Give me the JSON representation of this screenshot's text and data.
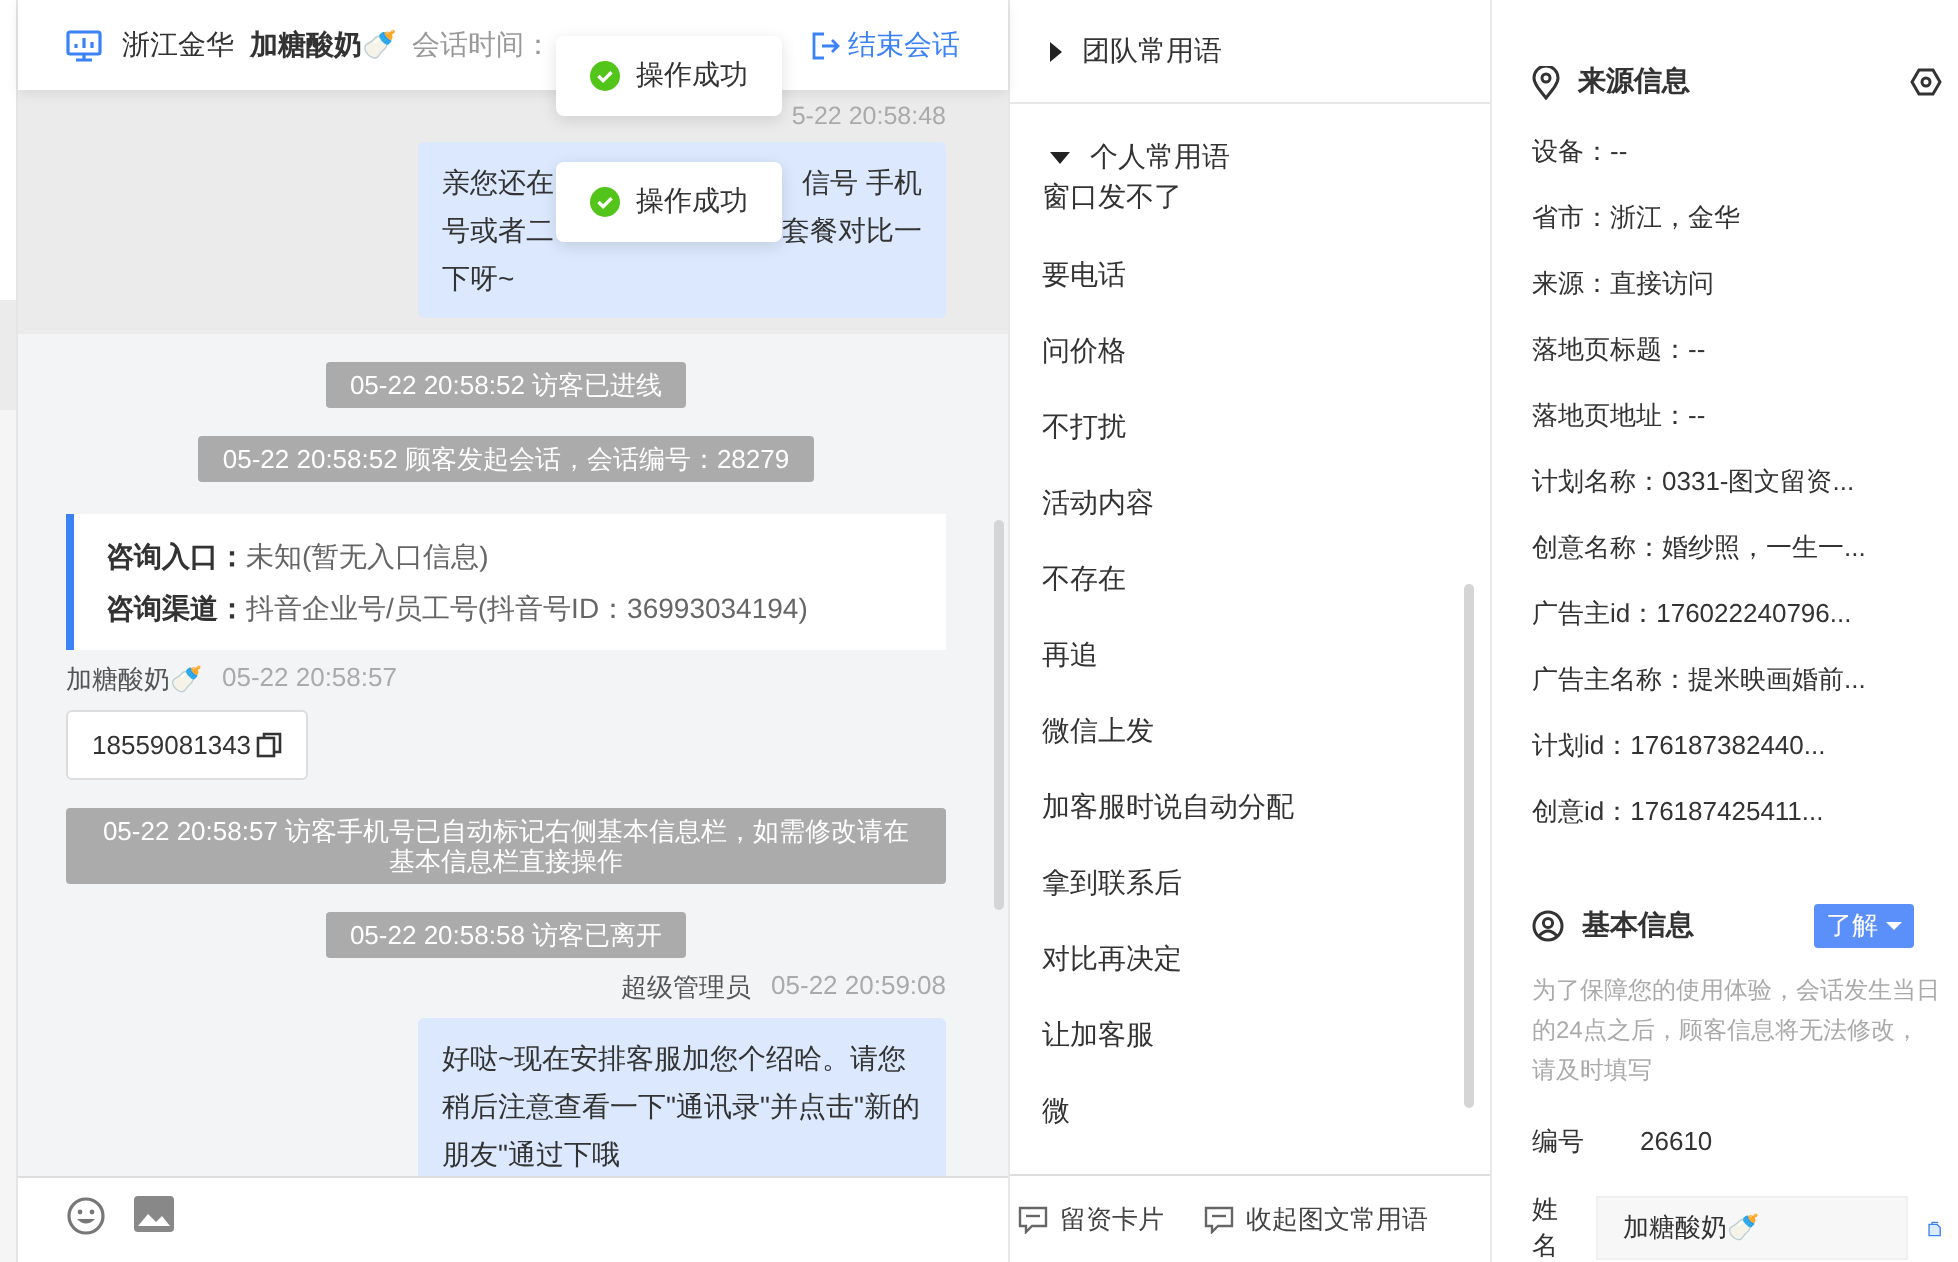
{
  "header": {
    "region": "浙江金华",
    "visitor": "加糖酸奶🍼",
    "session_time": "会话时间：",
    "end_button": "结束会话"
  },
  "toasts": [
    {
      "text": "操作成功"
    },
    {
      "text": "操作成功"
    }
  ],
  "messages": [
    {
      "kind": "agent_partial",
      "time": "5-22 20:58:48",
      "lines": [
        [
          "亲您还在",
          "信号 手机"
        ],
        [
          "号或者二",
          "套餐对比一"
        ],
        [
          "下呀~"
        ]
      ]
    },
    {
      "kind": "system",
      "text": "05-22 20:58:52 访客已进线"
    },
    {
      "kind": "system",
      "text": "05-22 20:58:52 顾客发起会话，会话编号：28279"
    },
    {
      "kind": "info",
      "rows": [
        {
          "label": "咨询入口：",
          "value": "未知(暂无入口信息)"
        },
        {
          "label": "咨询渠道：",
          "value": "抖音企业号/员工号(抖音号ID：36993034194)"
        }
      ]
    },
    {
      "kind": "visitor",
      "sender": "加糖酸奶🍼",
      "time": "05-22 20:58:57",
      "text": "18559081343"
    },
    {
      "kind": "system",
      "text": "05-22 20:58:57 访客手机号已自动标记右侧基本信息栏，如需修改请在基本信息栏直接操作"
    },
    {
      "kind": "system",
      "text": "05-22 20:58:58 访客已离开"
    },
    {
      "kind": "agent",
      "sender": "超级管理员",
      "time": "05-22 20:59:08",
      "text": "好哒~现在安排客服加您个绍哈。请您稍后注意查看一下\"通讯录\"并点击\"新的朋友\"通过下哦"
    }
  ],
  "phrases": {
    "groups": [
      {
        "title": "团队常用语",
        "expanded": false
      },
      {
        "title": "个人常用语",
        "expanded": true
      }
    ],
    "items": [
      "窗口发不了",
      "要电话",
      "问价格",
      "不打扰",
      "活动内容",
      "不存在",
      "再追",
      "微信上发",
      "加客服时说自动分配",
      "拿到联系后",
      "对比再决定",
      "让加客服",
      "微"
    ]
  },
  "footer_buttons": [
    "留资卡片",
    "收起图文常用语"
  ],
  "source_info": {
    "title": "来源信息",
    "rows": [
      "设备：--",
      "省市：浙江，金华",
      "来源：直接访问",
      "落地页标题：--",
      "落地页地址：--",
      "计划名称：0331-图文留资...",
      "创意名称：婚纱照，一生一...",
      "广告主id：176022240796...",
      "广告主名称：提米映画婚前...",
      "计划id：176187382440...",
      "创意id：176187425411..."
    ]
  },
  "basic_info": {
    "title": "基本信息",
    "learn_button": "了解",
    "hint": "为了保障您的使用体验，会话发生当日的24点之后，顾客信息将无法修改，请及时填写",
    "fields": [
      {
        "kind": "text",
        "label": "编号",
        "value": "26610"
      },
      {
        "kind": "input",
        "label": "姓名",
        "value": "加糖酸奶🍼"
      }
    ]
  }
}
